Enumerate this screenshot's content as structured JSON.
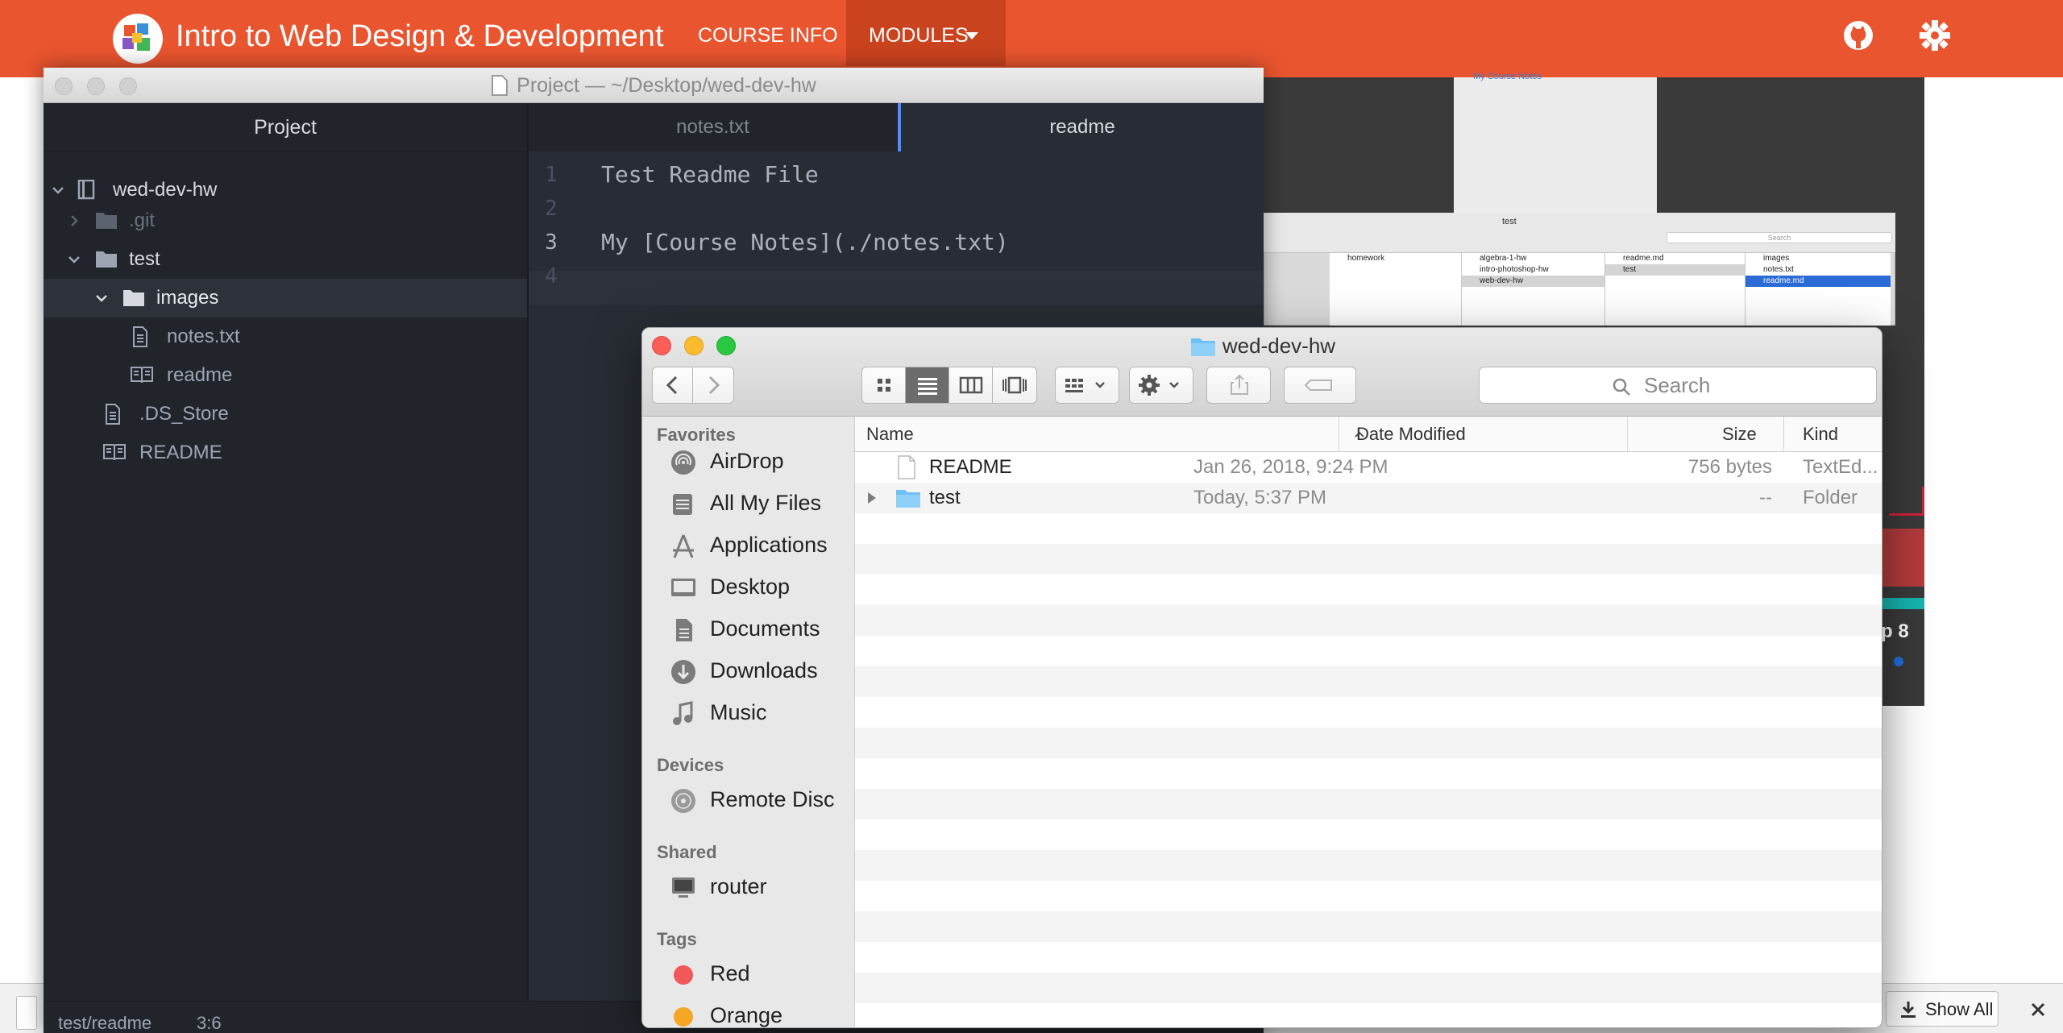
{
  "site": {
    "title": "Intro to Web Design & Development",
    "nav_course_info": "COURSE INFO",
    "nav_modules": "MODULES",
    "bg_note_text": "My Course Notes",
    "bg_shot_title": "test",
    "bg_shot_search": "Search",
    "bg_columns": [
      [
        "homework"
      ],
      [
        "algebra-1-hw",
        "intro-photoshop-hw",
        "web-dev-hw"
      ],
      [
        "readme.md",
        "test"
      ],
      [
        "images",
        "notes.txt",
        "readme.md"
      ]
    ],
    "bg_video_text": "p 8"
  },
  "atom": {
    "window_title": "Project — ~/Desktop/wed-dev-hw",
    "tree_header": "Project",
    "tree": [
      {
        "label": "wed-dev-hw",
        "kind": "root",
        "expanded": true
      },
      {
        "label": ".git",
        "kind": "folder",
        "expanded": false,
        "dim": true
      },
      {
        "label": "test",
        "kind": "folder",
        "expanded": true
      },
      {
        "label": "images",
        "kind": "folder",
        "expanded": true,
        "selected": true
      },
      {
        "label": "notes.txt",
        "kind": "file"
      },
      {
        "label": "readme",
        "kind": "book"
      },
      {
        "label": ".DS_Store",
        "kind": "file"
      },
      {
        "label": "README",
        "kind": "book"
      }
    ],
    "tabs": [
      "notes.txt",
      "readme"
    ],
    "active_tab": "readme",
    "line_numbers": [
      "1",
      "2",
      "3",
      "4"
    ],
    "code_lines": [
      "Test Readme File",
      "",
      "My [Course Notes](./notes.txt)",
      ""
    ],
    "status_path": "test/readme",
    "status_cursor": "3:6"
  },
  "finder": {
    "title": "wed-dev-hw",
    "search_placeholder": "Search",
    "favorites_header": "Favorites",
    "favorites": [
      {
        "label": "AirDrop",
        "icon": "airdrop-icon"
      },
      {
        "label": "All My Files",
        "icon": "all-files-icon"
      },
      {
        "label": "Applications",
        "icon": "applications-icon"
      },
      {
        "label": "Desktop",
        "icon": "desktop-icon"
      },
      {
        "label": "Documents",
        "icon": "documents-icon"
      },
      {
        "label": "Downloads",
        "icon": "downloads-icon"
      },
      {
        "label": "Music",
        "icon": "music-icon"
      }
    ],
    "devices_header": "Devices",
    "devices": [
      {
        "label": "Remote Disc",
        "icon": "remote-disc-icon"
      }
    ],
    "shared_header": "Shared",
    "shared": [
      {
        "label": "router",
        "icon": "computer-icon"
      }
    ],
    "tags_header": "Tags",
    "tags": [
      {
        "label": "Red",
        "color": "#f0585a"
      },
      {
        "label": "Orange",
        "color": "#f5a623"
      }
    ],
    "columns": {
      "name": "Name",
      "date": "Date Modified",
      "size": "Size",
      "kind": "Kind"
    },
    "files": [
      {
        "name": "README",
        "date": "Jan 26, 2018, 9:24 PM",
        "size": "756 bytes",
        "kind": "TextEd...",
        "type": "document"
      },
      {
        "name": "test",
        "date": "Today, 5:37 PM",
        "size": "--",
        "kind": "Folder",
        "type": "folder"
      }
    ]
  },
  "download_bar": {
    "show_all": "Show All"
  }
}
